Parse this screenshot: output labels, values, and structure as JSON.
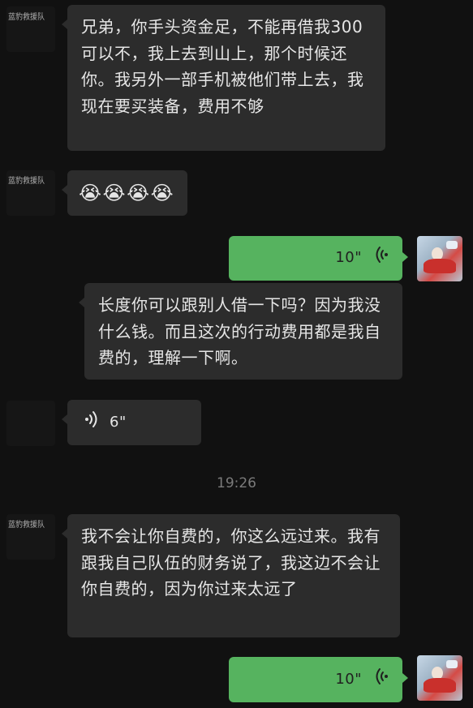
{
  "contact": {
    "name": "蓝豹救援队"
  },
  "messages": [
    {
      "from": "contact",
      "text": "兄弟，你手头资金足，不能再借我300可以不，我上去到山上，那个时候还你。我另外一部手机被他们带上去，我现在要买装备，费用不够"
    },
    {
      "from": "contact",
      "emoji": [
        "😭",
        "😭",
        "😭",
        "😭"
      ]
    },
    {
      "from": "me",
      "voice_duration": "10\""
    },
    {
      "from": "contact",
      "text": "长度你可以跟别人借一下吗？因为我没什么钱。而且这次的行动费用都是我自费的，理解一下啊。"
    },
    {
      "from": "contact",
      "voice_duration": "6\""
    },
    {
      "timestamp": "19:26"
    },
    {
      "from": "contact",
      "text": "我不会让你自费的，你这么远过来。我有跟我自己队伍的财务说了，我这边不会让你自费的，因为你过来太远了"
    },
    {
      "from": "me",
      "voice_duration": "10\""
    }
  ],
  "colors": {
    "background": "#111111",
    "incoming_bubble": "#2c2c2c",
    "outgoing_bubble": "#56b35f",
    "timestamp": "#7b7b7b"
  }
}
